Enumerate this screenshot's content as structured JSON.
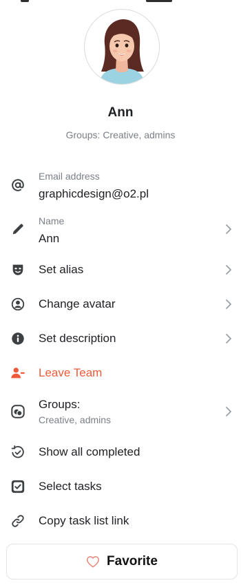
{
  "profile": {
    "name": "Ann",
    "groups_text": "Groups: Creative, admins"
  },
  "menu": {
    "email": {
      "label": "Email address",
      "value": "graphicdesign@o2.pl",
      "icon": "at-icon"
    },
    "name": {
      "label": "Name",
      "value": "Ann",
      "icon": "pencil-icon"
    },
    "set_alias": {
      "label": "Set alias",
      "icon": "mask-icon"
    },
    "change_avatar": {
      "label": "Change avatar",
      "icon": "user-circle-icon"
    },
    "set_description": {
      "label": "Set description",
      "icon": "info-icon"
    },
    "leave_team": {
      "label": "Leave Team",
      "icon": "user-minus-icon",
      "color": "#ee5a3a"
    },
    "groups": {
      "label": "Groups:",
      "value": "Creative, admins",
      "icon": "groups-icon"
    },
    "show_completed": {
      "label": "Show all completed",
      "icon": "history-check-icon"
    },
    "select_tasks": {
      "label": "Select tasks",
      "icon": "checkbox-icon"
    },
    "copy_link": {
      "label": "Copy task list link",
      "icon": "link-icon"
    }
  },
  "favorite": {
    "label": "Favorite",
    "icon": "heart-icon",
    "icon_color": "#e8857a"
  }
}
